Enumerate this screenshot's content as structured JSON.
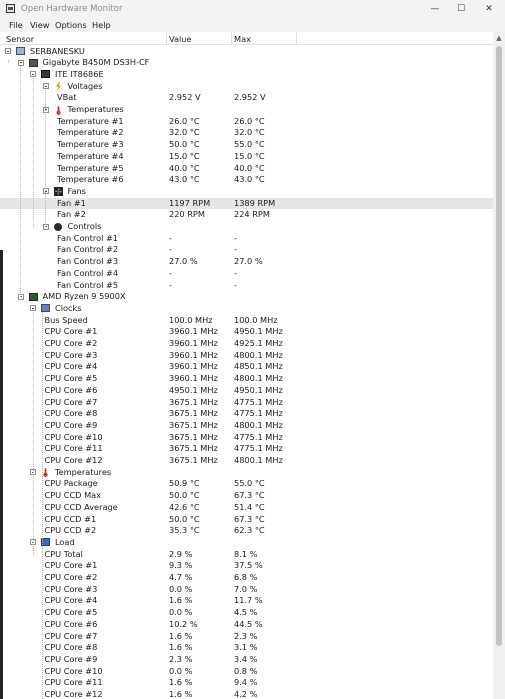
{
  "window": {
    "title": "Open Hardware Monitor",
    "minimize": "—",
    "maximize": "☐",
    "close": "✕"
  },
  "menu": [
    "File",
    "View",
    "Options",
    "Help"
  ],
  "columns": {
    "sensor": "Sensor",
    "value": "Value",
    "max": "Max"
  },
  "rows": [
    {
      "indent": 0,
      "type": "node",
      "icon": "computer",
      "name": "SERBANESKU"
    },
    {
      "indent": 1,
      "type": "node",
      "icon": "board",
      "name": "Gigabyte B450M DS3H-CF"
    },
    {
      "indent": 2,
      "type": "node",
      "icon": "chip",
      "name": "ITE IT8686E"
    },
    {
      "indent": 3,
      "type": "node",
      "icon": "voltage",
      "name": "Voltages"
    },
    {
      "indent": 4,
      "type": "leaf",
      "name": "VBat",
      "value": "2.952 V",
      "max": "2.952 V"
    },
    {
      "indent": 3,
      "type": "node",
      "icon": "temperature",
      "name": "Temperatures"
    },
    {
      "indent": 4,
      "type": "leaf",
      "name": "Temperature #1",
      "value": "26.0 °C",
      "max": "26.0 °C"
    },
    {
      "indent": 4,
      "type": "leaf",
      "name": "Temperature #2",
      "value": "32.0 °C",
      "max": "32.0 °C"
    },
    {
      "indent": 4,
      "type": "leaf",
      "name": "Temperature #3",
      "value": "50.0 °C",
      "max": "55.0 °C"
    },
    {
      "indent": 4,
      "type": "leaf",
      "name": "Temperature #4",
      "value": "15.0 °C",
      "max": "15.0 °C"
    },
    {
      "indent": 4,
      "type": "leaf",
      "name": "Temperature #5",
      "value": "40.0 °C",
      "max": "40.0 °C"
    },
    {
      "indent": 4,
      "type": "leaf",
      "name": "Temperature #6",
      "value": "43.0 °C",
      "max": "43.0 °C"
    },
    {
      "indent": 3,
      "type": "node",
      "icon": "fan",
      "name": "Fans"
    },
    {
      "indent": 4,
      "type": "leaf",
      "name": "Fan #1",
      "value": "1197 RPM",
      "max": "1389 RPM",
      "selected": true
    },
    {
      "indent": 4,
      "type": "leaf",
      "name": "Fan #2",
      "value": "220 RPM",
      "max": "224 RPM"
    },
    {
      "indent": 3,
      "type": "node",
      "icon": "control",
      "name": "Controls"
    },
    {
      "indent": 4,
      "type": "leaf",
      "name": "Fan Control #1",
      "value": "-",
      "max": "-"
    },
    {
      "indent": 4,
      "type": "leaf",
      "name": "Fan Control #2",
      "value": "-",
      "max": "-"
    },
    {
      "indent": 4,
      "type": "leaf",
      "name": "Fan Control #3",
      "value": "27.0 %",
      "max": "27.0 %"
    },
    {
      "indent": 4,
      "type": "leaf",
      "name": "Fan Control #4",
      "value": "-",
      "max": "-"
    },
    {
      "indent": 4,
      "type": "leaf",
      "name": "Fan Control #5",
      "value": "-",
      "max": "-"
    },
    {
      "indent": 1,
      "type": "node",
      "icon": "cpu",
      "name": "AMD Ryzen 9 5900X"
    },
    {
      "indent": 2,
      "type": "node",
      "icon": "clock",
      "name": "Clocks"
    },
    {
      "indent": 3,
      "type": "leaf",
      "name": "Bus Speed",
      "value": "100.0 MHz",
      "max": "100.0 MHz"
    },
    {
      "indent": 3,
      "type": "leaf",
      "name": "CPU Core #1",
      "value": "3960.1 MHz",
      "max": "4950.1 MHz"
    },
    {
      "indent": 3,
      "type": "leaf",
      "name": "CPU Core #2",
      "value": "3960.1 MHz",
      "max": "4925.1 MHz"
    },
    {
      "indent": 3,
      "type": "leaf",
      "name": "CPU Core #3",
      "value": "3960.1 MHz",
      "max": "4800.1 MHz"
    },
    {
      "indent": 3,
      "type": "leaf",
      "name": "CPU Core #4",
      "value": "3960.1 MHz",
      "max": "4850.1 MHz"
    },
    {
      "indent": 3,
      "type": "leaf",
      "name": "CPU Core #5",
      "value": "3960.1 MHz",
      "max": "4800.1 MHz"
    },
    {
      "indent": 3,
      "type": "leaf",
      "name": "CPU Core #6",
      "value": "4950.1 MHz",
      "max": "4950.1 MHz"
    },
    {
      "indent": 3,
      "type": "leaf",
      "name": "CPU Core #7",
      "value": "3675.1 MHz",
      "max": "4775.1 MHz"
    },
    {
      "indent": 3,
      "type": "leaf",
      "name": "CPU Core #8",
      "value": "3675.1 MHz",
      "max": "4775.1 MHz"
    },
    {
      "indent": 3,
      "type": "leaf",
      "name": "CPU Core #9",
      "value": "3675.1 MHz",
      "max": "4800.1 MHz"
    },
    {
      "indent": 3,
      "type": "leaf",
      "name": "CPU Core #10",
      "value": "3675.1 MHz",
      "max": "4775.1 MHz"
    },
    {
      "indent": 3,
      "type": "leaf",
      "name": "CPU Core #11",
      "value": "3675.1 MHz",
      "max": "4775.1 MHz"
    },
    {
      "indent": 3,
      "type": "leaf",
      "name": "CPU Core #12",
      "value": "3675.1 MHz",
      "max": "4800.1 MHz"
    },
    {
      "indent": 2,
      "type": "node",
      "icon": "temperature",
      "name": "Temperatures"
    },
    {
      "indent": 3,
      "type": "leaf",
      "name": "CPU Package",
      "value": "50.9 °C",
      "max": "55.0 °C"
    },
    {
      "indent": 3,
      "type": "leaf",
      "name": "CPU CCD Max",
      "value": "50.0 °C",
      "max": "67.3 °C"
    },
    {
      "indent": 3,
      "type": "leaf",
      "name": "CPU CCD Average",
      "value": "42.6 °C",
      "max": "51.4 °C"
    },
    {
      "indent": 3,
      "type": "leaf",
      "name": "CPU CCD #1",
      "value": "50.0 °C",
      "max": "67.3 °C"
    },
    {
      "indent": 3,
      "type": "leaf",
      "name": "CPU CCD #2",
      "value": "35.3 °C",
      "max": "62.3 °C"
    },
    {
      "indent": 2,
      "type": "node",
      "icon": "load",
      "name": "Load"
    },
    {
      "indent": 3,
      "type": "leaf",
      "name": "CPU Total",
      "value": "2.9 %",
      "max": "8.1 %"
    },
    {
      "indent": 3,
      "type": "leaf",
      "name": "CPU Core #1",
      "value": "9.3 %",
      "max": "37.5 %"
    },
    {
      "indent": 3,
      "type": "leaf",
      "name": "CPU Core #2",
      "value": "4.7 %",
      "max": "6.8 %"
    },
    {
      "indent": 3,
      "type": "leaf",
      "name": "CPU Core #3",
      "value": "0.0 %",
      "max": "7.0 %"
    },
    {
      "indent": 3,
      "type": "leaf",
      "name": "CPU Core #4",
      "value": "1.6 %",
      "max": "11.7 %"
    },
    {
      "indent": 3,
      "type": "leaf",
      "name": "CPU Core #5",
      "value": "0.0 %",
      "max": "4.5 %"
    },
    {
      "indent": 3,
      "type": "leaf",
      "name": "CPU Core #6",
      "value": "10.2 %",
      "max": "44.5 %"
    },
    {
      "indent": 3,
      "type": "leaf",
      "name": "CPU Core #7",
      "value": "1.6 %",
      "max": "2.3 %"
    },
    {
      "indent": 3,
      "type": "leaf",
      "name": "CPU Core #8",
      "value": "1.6 %",
      "max": "3.1 %"
    },
    {
      "indent": 3,
      "type": "leaf",
      "name": "CPU Core #9",
      "value": "2.3 %",
      "max": "3.4 %"
    },
    {
      "indent": 3,
      "type": "leaf",
      "name": "CPU Core #10",
      "value": "0.0 %",
      "max": "0.8 %"
    },
    {
      "indent": 3,
      "type": "leaf",
      "name": "CPU Core #11",
      "value": "1.6 %",
      "max": "9.4 %"
    },
    {
      "indent": 3,
      "type": "leaf",
      "name": "CPU Core #12",
      "value": "1.6 %",
      "max": "4.2 %"
    }
  ]
}
